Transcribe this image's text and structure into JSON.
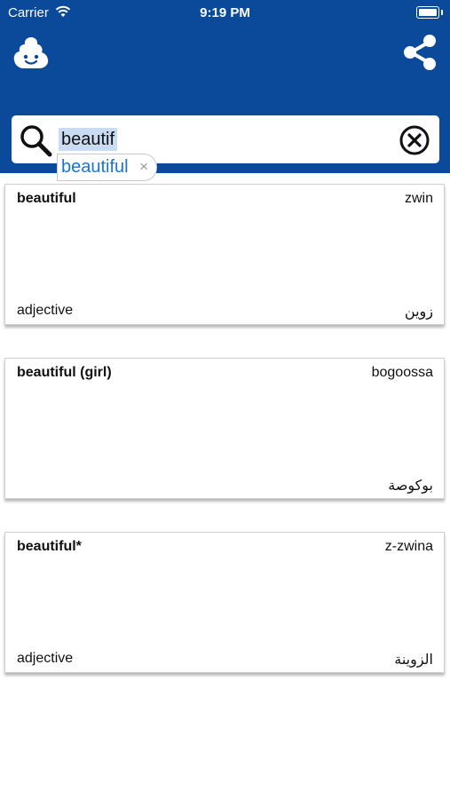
{
  "status_bar": {
    "carrier": "Carrier",
    "time": "9:19 PM",
    "battery_level": 1.0
  },
  "header": {
    "background_color": "#0b4a9a",
    "logo_icon": "cloud-mascot-icon",
    "share_icon": "share-icon"
  },
  "search": {
    "value": "beautif",
    "search_icon": "search-icon",
    "clear_icon": "clear-circle-x-icon"
  },
  "suggestion": {
    "text": "beautiful",
    "dismiss": "×",
    "color": "#1a73d9"
  },
  "results": [
    {
      "term": "beautiful",
      "transliteration": "zwin",
      "part_of_speech": "adjective",
      "arabic": "زوين"
    },
    {
      "term": "beautiful (girl)",
      "transliteration": "bogoossa",
      "part_of_speech": "",
      "arabic": "بوكوصة"
    },
    {
      "term": "beautiful*",
      "transliteration": "z-zwina",
      "part_of_speech": "adjective",
      "arabic": "الزوينة"
    }
  ]
}
